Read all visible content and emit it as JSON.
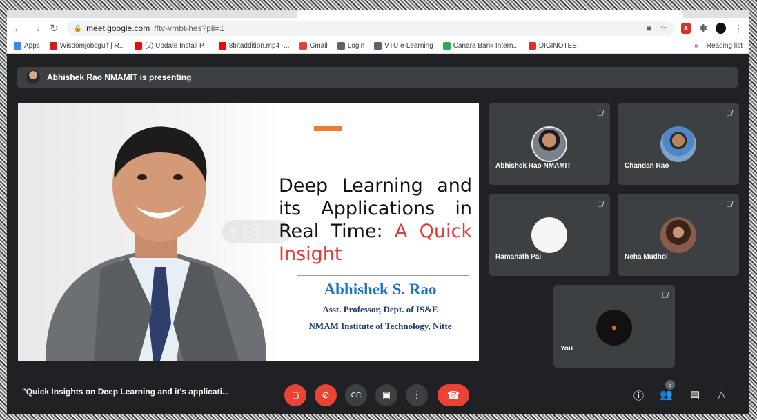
{
  "browser": {
    "url_host": "meet.google.com",
    "url_path": "/ftv-vmbt-hes?pli=1",
    "bookmarks": [
      {
        "label": "Apps",
        "color": "#4285f4"
      },
      {
        "label": "Wisdomjobsgulf | R...",
        "color": "#c5221f"
      },
      {
        "label": "(2) Update Install P...",
        "color": "#ff0000"
      },
      {
        "label": "8bitaddition.mp4 -...",
        "color": "#ff0000"
      },
      {
        "label": "Gmail",
        "color": "#ea4335"
      },
      {
        "label": "Login",
        "color": "#5f6368"
      },
      {
        "label": "VTU e-Learning",
        "color": "#5f6368"
      },
      {
        "label": "Canara Bank Intern...",
        "color": "#34a853"
      },
      {
        "label": "DIGINOTES",
        "color": "#d93025"
      }
    ],
    "more_label": "»",
    "reading_list": "Reading list"
  },
  "meet": {
    "presenting_banner": "Abhishek Rao NMAMIT is presenting",
    "slide": {
      "title_black": "Deep Learning and its Applications in Real Time:",
      "title_red": "A Quick Insight",
      "speaker_name": "Abhishek S. Rao",
      "speaker_role": "Asst. Professor, Dept. of IS&E",
      "speaker_org": "NMAM Institute of Technology, Nitte",
      "accent_color": "#f07b2e"
    },
    "participants": [
      {
        "name": "Abhishek Rao NMAMIT",
        "avatar": "photo-man-suit"
      },
      {
        "name": "Chandan Rao",
        "avatar": "photo-man-outdoor"
      },
      {
        "name": "Ramanath Pai",
        "avatar": "blank-white"
      },
      {
        "name": "Neha Mudhol",
        "avatar": "photo-woman"
      },
      {
        "name": "You",
        "avatar": "logo-dark"
      }
    ],
    "meeting_title": "\"Quick Insights on Deep Learning and it's applicati...",
    "people_count": "6",
    "colors": {
      "danger": "#ea4335",
      "tile": "#3c4043",
      "bg": "#202124"
    }
  }
}
